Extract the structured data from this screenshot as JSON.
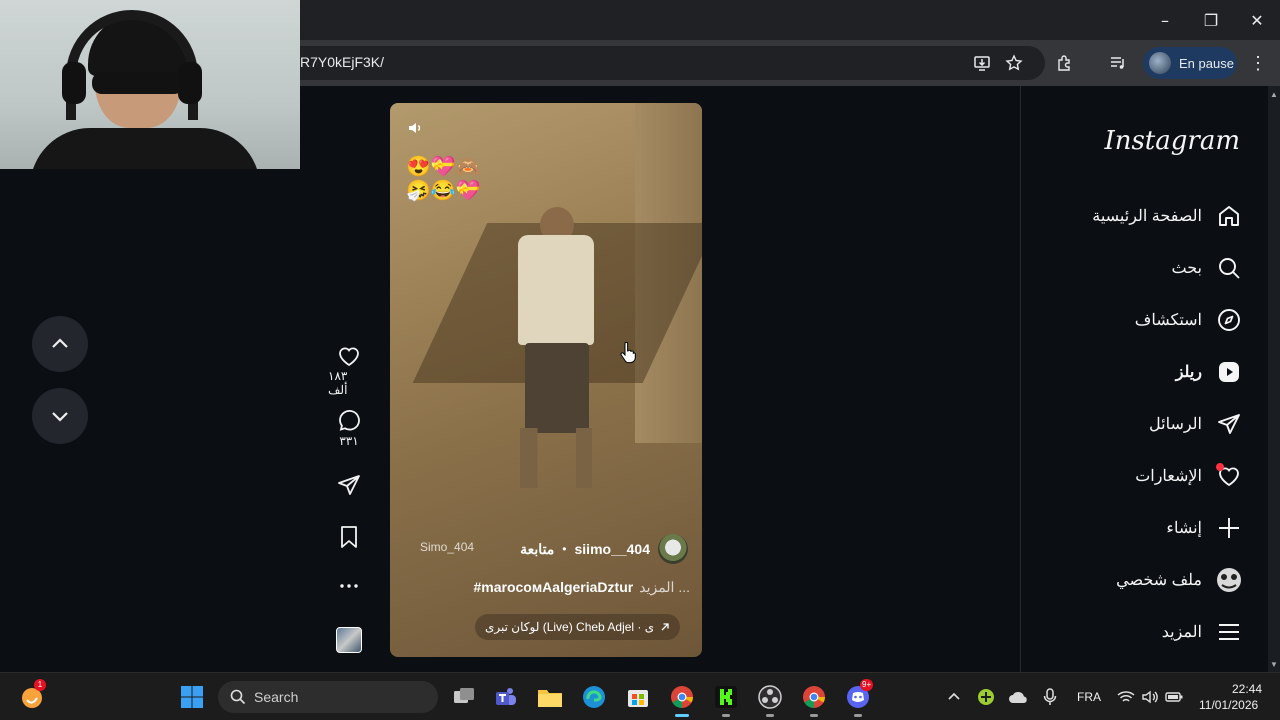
{
  "browser": {
    "url": "R7Y0kEjF3K/",
    "profile_label": "En pause"
  },
  "video": {
    "watermark": "Simo_404",
    "username": "siimo__404",
    "separator": "•",
    "follow_label": "متابعة",
    "caption_tags": "#marocoмAalgeriaDztur",
    "caption_more": "المزيد ...",
    "audio": "لوكان تبرى (Live)  Cheb Adjel · ى",
    "stickers": "😍💝🙈\n🤧😂💝"
  },
  "actions": {
    "likes": "١٨٣ ألف",
    "comments": "٣٣١"
  },
  "sidebar": {
    "logo": "Instagram",
    "items": [
      {
        "label": "الصفحة الرئيسية",
        "icon": "home-icon"
      },
      {
        "label": "بحث",
        "icon": "search-icon"
      },
      {
        "label": "استكشاف",
        "icon": "compass-icon"
      },
      {
        "label": "ريلز",
        "icon": "reels-icon"
      },
      {
        "label": "الرسائل",
        "icon": "paper-plane-icon"
      },
      {
        "label": "الإشعارات",
        "icon": "heart-icon"
      },
      {
        "label": "إنشاء",
        "icon": "plus-icon"
      },
      {
        "label": "ملف شخصي",
        "icon": "profile-avatar-icon"
      },
      {
        "label": "المزيد",
        "icon": "menu-icon"
      }
    ]
  },
  "taskbar": {
    "search_label": "Search",
    "language": "FRA",
    "time": "22:44",
    "date": "11/01/2026",
    "badges": {
      "left_app": "1",
      "discord": "9+"
    }
  },
  "colors": {
    "page_bg": "#0b0f14",
    "accent_profile": "#1f3a60",
    "notification_dot": "#ff3040"
  }
}
